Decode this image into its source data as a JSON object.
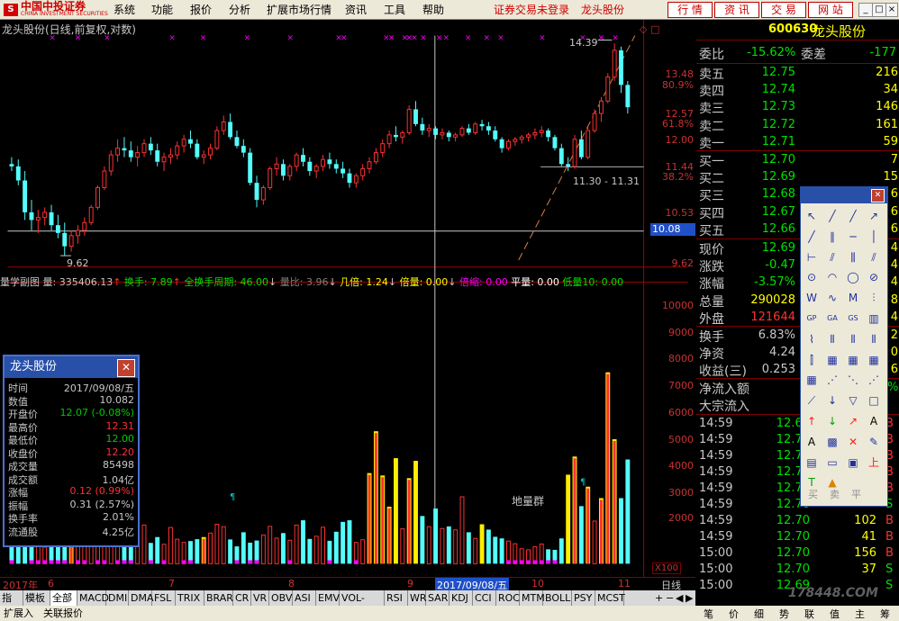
{
  "menubar": {
    "logo_mark": "S",
    "brand": "中国中投证券",
    "brand_en": "CHINA INVESTMENT SECURITIES",
    "items": [
      "系统",
      "功能",
      "报价",
      "分析",
      "扩展市场行情",
      "资讯",
      "工具",
      "帮助"
    ],
    "status": "证券交易未登录",
    "stock": "龙头股份",
    "buttons": [
      "行 情",
      "资 讯",
      "交 易",
      "网 站"
    ]
  },
  "chart": {
    "title": "龙头股份(日线,前复权,对数)",
    "price_labels": [
      "13.48",
      "80.9%",
      "12.57",
      "61.8%",
      "12.00",
      "11.44",
      "38.2%",
      "10.53",
      "10.08",
      "9.62"
    ],
    "annot_high": "14.39",
    "annot_low": "9.62",
    "annot_range": "11.30 - 11.31",
    "vol_title": {
      "main": "量学副图",
      "vol": "量: 335406.13",
      "hs": "换手: 7.89",
      "qhs": "全换手周期: 46.00",
      "lb": "量比: 3.96",
      "jb": "几倍: 1.24",
      "bl": "倍量: 0.00",
      "bs": "倍缩: 0.00",
      "pl": "平量: 0.00",
      "dl": "低量10: 0.00"
    },
    "vol_labels": [
      "10000",
      "9000",
      "8000",
      "7000",
      "6000",
      "5000",
      "4000",
      "3000",
      "2000"
    ],
    "vol_unit": "X100",
    "annotation_diliangqun": "地量群",
    "date_labels": [
      "2017年",
      "6",
      "7",
      "8",
      "9",
      "2017/09/08/五",
      "10",
      "11"
    ],
    "period_label": "日线"
  },
  "chart_data": {
    "type": "candlestick",
    "title": "龙头股份(日线,前复权,对数)",
    "ylim": [
      9.5,
      14.6
    ],
    "candles": [
      [
        11.45,
        11.6,
        11.3,
        11.4
      ],
      [
        11.4,
        11.55,
        11.0,
        11.1
      ],
      [
        11.1,
        11.3,
        10.3,
        10.45
      ],
      [
        10.45,
        10.7,
        10.1,
        10.3
      ],
      [
        10.3,
        10.5,
        10.05,
        10.35
      ],
      [
        10.35,
        10.55,
        10.2,
        10.45
      ],
      [
        10.45,
        10.6,
        10.1,
        10.2
      ],
      [
        10.2,
        10.4,
        9.95,
        10.05
      ],
      [
        10.05,
        10.25,
        9.62,
        9.8
      ],
      [
        9.8,
        10.1,
        9.7,
        10.0
      ],
      [
        10.0,
        10.2,
        9.85,
        10.1
      ],
      [
        10.1,
        10.35,
        10.0,
        10.25
      ],
      [
        10.25,
        10.6,
        10.2,
        10.55
      ],
      [
        10.55,
        11.0,
        10.5,
        10.95
      ],
      [
        10.95,
        11.4,
        10.9,
        11.3
      ],
      [
        11.3,
        11.75,
        11.2,
        11.65
      ],
      [
        11.65,
        12.0,
        11.5,
        11.8
      ],
      [
        11.8,
        12.05,
        11.6,
        11.75
      ],
      [
        11.75,
        11.95,
        11.5,
        11.6
      ],
      [
        11.6,
        11.85,
        11.4,
        11.7
      ],
      [
        11.7,
        12.0,
        11.6,
        11.9
      ],
      [
        11.9,
        12.05,
        11.65,
        11.75
      ],
      [
        11.75,
        11.9,
        11.4,
        11.5
      ],
      [
        11.5,
        11.7,
        11.3,
        11.6
      ],
      [
        11.6,
        11.8,
        11.45,
        11.65
      ],
      [
        11.65,
        11.95,
        11.55,
        11.85
      ],
      [
        11.85,
        12.1,
        11.7,
        12.0
      ],
      [
        12.0,
        12.2,
        11.8,
        11.9
      ],
      [
        11.9,
        12.0,
        11.55,
        11.6
      ],
      [
        11.6,
        11.75,
        11.45,
        11.65
      ],
      [
        11.65,
        11.9,
        11.55,
        11.8
      ],
      [
        11.8,
        12.3,
        11.75,
        12.2
      ],
      [
        12.2,
        12.55,
        12.1,
        12.4
      ],
      [
        12.4,
        12.6,
        12.0,
        12.05
      ],
      [
        12.05,
        12.2,
        11.8,
        11.85
      ],
      [
        11.85,
        12.0,
        11.6,
        11.7
      ],
      [
        11.7,
        11.8,
        11.0,
        11.05
      ],
      [
        11.05,
        11.2,
        10.55,
        10.7
      ],
      [
        10.7,
        11.0,
        10.6,
        10.95
      ],
      [
        10.95,
        11.4,
        10.9,
        11.35
      ],
      [
        11.35,
        11.6,
        11.2,
        11.45
      ],
      [
        11.45,
        11.55,
        11.1,
        11.2
      ],
      [
        11.2,
        11.45,
        11.1,
        11.4
      ],
      [
        11.4,
        11.7,
        11.3,
        11.65
      ],
      [
        11.65,
        11.8,
        11.4,
        11.5
      ],
      [
        11.5,
        11.6,
        11.2,
        11.3
      ],
      [
        11.3,
        11.45,
        11.15,
        11.4
      ],
      [
        11.4,
        11.65,
        11.3,
        11.55
      ],
      [
        11.55,
        11.7,
        11.35,
        11.45
      ],
      [
        11.45,
        11.55,
        11.25,
        11.35
      ],
      [
        11.35,
        11.5,
        11.15,
        11.25
      ],
      [
        11.25,
        11.35,
        10.95,
        11.05
      ],
      [
        11.05,
        11.25,
        10.95,
        11.2
      ],
      [
        11.2,
        11.45,
        11.1,
        11.35
      ],
      [
        11.35,
        11.6,
        11.25,
        11.5
      ],
      [
        11.5,
        11.8,
        11.45,
        11.7
      ],
      [
        11.7,
        12.0,
        11.6,
        11.9
      ],
      [
        11.9,
        12.2,
        11.8,
        12.1
      ],
      [
        12.1,
        12.3,
        11.95,
        12.05
      ],
      [
        12.05,
        12.2,
        11.9,
        12.15
      ],
      [
        12.15,
        12.8,
        12.1,
        12.7
      ],
      [
        12.7,
        12.9,
        12.3,
        12.35
      ],
      [
        12.35,
        12.5,
        12.1,
        12.2
      ],
      [
        12.2,
        12.35,
        12.05,
        12.25
      ],
      [
        12.25,
        12.3,
        12.0,
        12.1
      ],
      [
        12.1,
        12.25,
        12.0,
        12.15
      ],
      [
        12.15,
        12.2,
        11.95,
        12.05
      ],
      [
        12.05,
        12.15,
        11.95,
        12.1
      ],
      [
        12.1,
        12.3,
        12.05,
        12.25
      ],
      [
        12.25,
        12.35,
        12.1,
        12.15
      ],
      [
        12.15,
        12.4,
        12.1,
        12.35
      ],
      [
        12.35,
        12.45,
        12.2,
        12.3
      ],
      [
        12.3,
        12.4,
        12.1,
        12.2
      ],
      [
        12.2,
        12.3,
        11.95,
        12.0
      ],
      [
        12.0,
        12.05,
        11.7,
        11.8
      ],
      [
        11.8,
        12.0,
        11.75,
        11.95
      ],
      [
        11.95,
        12.05,
        11.85,
        12.0
      ],
      [
        12.0,
        12.1,
        11.9,
        12.05
      ],
      [
        12.05,
        12.15,
        11.95,
        12.1
      ],
      [
        12.1,
        12.25,
        12.0,
        12.15
      ],
      [
        12.15,
        12.3,
        12.05,
        12.2
      ],
      [
        12.2,
        12.25,
        11.95,
        12.05
      ],
      [
        12.05,
        12.1,
        11.75,
        11.8
      ],
      [
        11.8,
        11.9,
        11.4,
        11.45
      ],
      [
        11.45,
        11.6,
        11.3,
        11.4
      ],
      [
        11.4,
        12.1,
        11.35,
        12.0
      ],
      [
        12.0,
        12.2,
        11.55,
        11.6
      ],
      [
        11.6,
        12.3,
        11.55,
        12.2
      ],
      [
        12.2,
        12.7,
        12.15,
        12.6
      ],
      [
        12.6,
        13.0,
        12.4,
        12.9
      ],
      [
        12.9,
        13.6,
        12.85,
        13.5
      ],
      [
        13.5,
        14.39,
        13.4,
        14.2
      ],
      [
        14.2,
        14.3,
        13.1,
        13.3
      ],
      [
        13.3,
        13.4,
        12.6,
        12.75
      ]
    ],
    "volumes": [
      [
        760,
        0
      ],
      [
        900,
        0
      ],
      [
        950,
        0
      ],
      [
        700,
        0
      ],
      [
        830,
        0
      ],
      [
        620,
        0
      ],
      [
        780,
        0
      ],
      [
        700,
        0
      ],
      [
        650,
        0
      ],
      [
        900,
        1
      ],
      [
        720,
        0
      ],
      [
        880,
        0
      ],
      [
        1000,
        0
      ],
      [
        760,
        0
      ],
      [
        820,
        0
      ],
      [
        950,
        0
      ],
      [
        700,
        0
      ],
      [
        880,
        0
      ],
      [
        630,
        0
      ],
      [
        910,
        0
      ],
      [
        1450,
        0
      ],
      [
        780,
        0
      ],
      [
        1000,
        0
      ],
      [
        730,
        0
      ],
      [
        1360,
        0
      ],
      [
        920,
        0
      ],
      [
        800,
        0
      ],
      [
        850,
        0
      ],
      [
        920,
        0
      ],
      [
        1000,
        1
      ],
      [
        1150,
        0
      ],
      [
        1480,
        0
      ],
      [
        1390,
        0
      ],
      [
        910,
        0
      ],
      [
        650,
        0
      ],
      [
        1180,
        0
      ],
      [
        790,
        0
      ],
      [
        870,
        0
      ],
      [
        1080,
        0
      ],
      [
        1400,
        0
      ],
      [
        960,
        0
      ],
      [
        1150,
        0
      ],
      [
        880,
        0
      ],
      [
        1450,
        0
      ],
      [
        1630,
        0
      ],
      [
        930,
        0
      ],
      [
        1030,
        0
      ],
      [
        1370,
        0
      ],
      [
        860,
        0
      ],
      [
        1200,
        0
      ],
      [
        1570,
        0
      ],
      [
        1630,
        0
      ],
      [
        800,
        0
      ],
      [
        900,
        0
      ],
      [
        3400,
        1
      ],
      [
        4970,
        1
      ],
      [
        3310,
        1
      ],
      [
        2140,
        1
      ],
      [
        3960,
        1
      ],
      [
        1310,
        0
      ],
      [
        3210,
        1
      ],
      [
        3860,
        1
      ],
      [
        1790,
        0
      ],
      [
        1390,
        0
      ],
      [
        2070,
        0
      ],
      [
        1320,
        0
      ],
      [
        1400,
        0
      ],
      [
        1270,
        0
      ],
      [
        2510,
        0
      ],
      [
        1180,
        0
      ],
      [
        950,
        0
      ],
      [
        1480,
        1
      ],
      [
        1280,
        0
      ],
      [
        1010,
        0
      ],
      [
        950,
        0
      ],
      [
        850,
        0
      ],
      [
        750,
        0
      ],
      [
        560,
        0
      ],
      [
        520,
        0
      ],
      [
        640,
        0
      ],
      [
        740,
        0
      ],
      [
        540,
        0
      ],
      [
        520,
        0
      ],
      [
        950,
        0
      ],
      [
        3340,
        1
      ],
      [
        4020,
        1
      ],
      [
        2160,
        0
      ],
      [
        2890,
        1
      ],
      [
        1600,
        0
      ],
      [
        2460,
        1
      ],
      [
        7180,
        1
      ],
      [
        4670,
        1
      ],
      [
        2460,
        0
      ],
      [
        3910,
        0
      ]
    ],
    "vol_ylim": [
      0,
      10500
    ]
  },
  "panel": {
    "code": "600630",
    "name": "龙头股份",
    "webi_label": "委比",
    "webi": "-15.62%",
    "wecha_label": "委差",
    "wecha": "-177",
    "sells": [
      {
        "l": "卖五",
        "p": "12.75",
        "v": "216"
      },
      {
        "l": "卖四",
        "p": "12.74",
        "v": "34"
      },
      {
        "l": "卖三",
        "p": "12.73",
        "v": "146"
      },
      {
        "l": "卖二",
        "p": "12.72",
        "v": "161"
      },
      {
        "l": "卖一",
        "p": "12.71",
        "v": "59"
      }
    ],
    "buys": [
      {
        "l": "买一",
        "p": "12.70",
        "v": "7"
      },
      {
        "l": "买二",
        "p": "12.69",
        "v": "15"
      },
      {
        "l": "买三",
        "p": "12.68",
        "v": "6"
      },
      {
        "l": "买四",
        "p": "12.67",
        "v": "6"
      },
      {
        "l": "买五",
        "p": "12.66",
        "v": "6"
      }
    ],
    "stats": [
      {
        "l": "现价",
        "v": "12.69",
        "e": "4"
      },
      {
        "l": "涨跌",
        "v": "-0.47",
        "e": "4"
      },
      {
        "l": "涨幅",
        "v": "-3.57%",
        "e": "4"
      },
      {
        "l": "总量",
        "v": "290028",
        "e": "8"
      },
      {
        "l": "外盘",
        "v": "121644",
        "e": "4"
      }
    ],
    "stats2": [
      {
        "l": "换手",
        "v": "6.83%",
        "e": "2"
      },
      {
        "l": "净资",
        "v": "4.24",
        "e": "0"
      },
      {
        "l": "收益(三)",
        "v": "0.253",
        "e": "6"
      }
    ],
    "netflow_label": "净流入额",
    "bigorder_label": "大宗流入",
    "netflow_pct": "%",
    "trades": [
      {
        "t": "14:59",
        "p": "12.69",
        "v": "",
        "d": "B"
      },
      {
        "t": "14:59",
        "p": "12.70",
        "v": "",
        "d": "B"
      },
      {
        "t": "14:59",
        "p": "12.70",
        "v": "",
        "d": "B"
      },
      {
        "t": "14:59",
        "p": "12.70",
        "v": "",
        "d": "B"
      },
      {
        "t": "14:59",
        "p": "12.70",
        "v": "",
        "d": "B"
      },
      {
        "t": "14:59",
        "p": "12.70",
        "v": "",
        "d": "S"
      },
      {
        "t": "14:59",
        "p": "12.70",
        "v": "102",
        "d": "B"
      },
      {
        "t": "14:59",
        "p": "12.70",
        "v": "41",
        "d": "B"
      },
      {
        "t": "15:00",
        "p": "12.70",
        "v": "156",
        "d": "B"
      },
      {
        "t": "15:00",
        "p": "12.70",
        "v": "37",
        "d": "S"
      },
      {
        "t": "15:00",
        "p": "12.69",
        "v": "",
        "d": "S"
      }
    ],
    "tabs": [
      "笔",
      "价",
      "细",
      "势",
      "联",
      "值",
      "主",
      "筹"
    ]
  },
  "infobox": {
    "title": "龙头股份",
    "rows": [
      {
        "k": "时间",
        "v": "2017/09/08/五",
        "c": "#c8c8c8"
      },
      {
        "k": "数值",
        "v": "10.082",
        "c": "#c8c8c8"
      },
      {
        "k": "开盘价",
        "v": "12.07 (-0.08%)",
        "c": "#00cc00"
      },
      {
        "k": "最高价",
        "v": "12.31",
        "c": "#ff3030"
      },
      {
        "k": "最低价",
        "v": "12.00",
        "c": "#00cc00"
      },
      {
        "k": "收盘价",
        "v": "12.20",
        "c": "#ff3030"
      },
      {
        "k": "成交量",
        "v": "85498",
        "c": "#c8c8c8"
      },
      {
        "k": "成交额",
        "v": "1.04亿",
        "c": "#c8c8c8"
      },
      {
        "k": "涨幅",
        "v": "0.12 (0.99%)",
        "c": "#ff3030"
      },
      {
        "k": "振幅",
        "v": "0.31 (2.57%)",
        "c": "#c8c8c8"
      },
      {
        "k": "换手率",
        "v": "2.01%",
        "c": "#c8c8c8"
      },
      {
        "k": "流通股",
        "v": "4.25亿",
        "c": "#c8c8c8"
      }
    ]
  },
  "toolbox": {
    "buy_label": "买",
    "sell_label": "卖",
    "flat_label": "平",
    "text_tool": "A",
    "text_tool2": "'A'",
    "icons": [
      "cursor-icon",
      "line-icon",
      "segment-icon",
      "ray-icon",
      "arrow-line-icon",
      "parallel-icon",
      "horizontal-line-icon",
      "vertical-line-icon",
      "price-line-icon",
      "channel-icon",
      "fibonacci-icon",
      "gann-icon",
      "circle-icon",
      "arc-icon",
      "ellipse-icon",
      "no-icon",
      "w-pattern-icon",
      "wave-icon",
      "m-pattern-icon",
      "zigzag-icon",
      "gp-icon",
      "ga-icon",
      "gs-icon",
      "bar-icon",
      "period-icon",
      "cycle-icon",
      "cycle2-icon",
      "cycle3-icon",
      "fib-time-icon",
      "box-icon",
      "box2-icon",
      "box3-icon",
      "box4-icon",
      "fan-icon",
      "fan2-icon",
      "fan3-icon",
      "speed-line-icon",
      "down-arrow-icon",
      "down-triangle-icon",
      "rect-icon",
      "up-arrow-red-icon",
      "down-arrow-green-icon",
      "arrow-icon",
      "text-icon",
      "text2-icon",
      "block-icon",
      "delete-icon",
      "brush-icon",
      "note-icon",
      "ruler-icon",
      "capture-icon",
      "up-mark-icon",
      "t-mark-icon",
      "triangle-mark-icon"
    ]
  },
  "bottombar": {
    "tabs": [
      "指标",
      "模板",
      "全部",
      "MACD",
      "DMI",
      "DMA",
      "FSL",
      "TRIX",
      "BRAR",
      "CR",
      "VR",
      "OBV",
      "ASI",
      "EMV",
      "VOL-TDX",
      "RSI",
      "WR",
      "SAR",
      "KDJ",
      "CCI",
      "ROC",
      "MTM",
      "BOLL",
      "PSY",
      "MCST"
    ],
    "right": [
      "+",
      "−",
      "◀",
      "▶"
    ]
  },
  "statusbar": {
    "items": [
      "扩展入",
      "关联报价"
    ],
    "watermark": "178448.COM"
  },
  "colors": {
    "up": "#ff3232",
    "down": "#54fcfc",
    "grid": "#800000",
    "yellow": "#ffff00",
    "magenta": "#ff00ff"
  }
}
